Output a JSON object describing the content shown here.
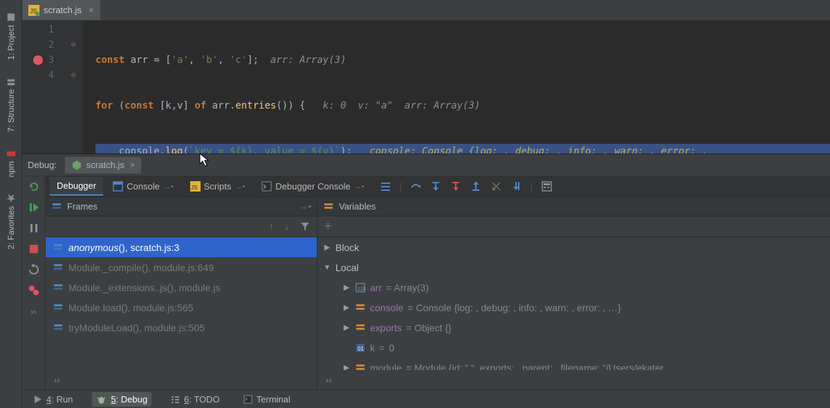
{
  "left_bar": {
    "project": "1: Project",
    "structure": "7: Structure",
    "npm": "npm",
    "favorites": "2: Favorites"
  },
  "editor_tab": {
    "filename": "scratch.js"
  },
  "code": {
    "line1": {
      "kw_const": "const",
      "arr": " arr ",
      "eq": "= [",
      "a": "'a'",
      "c1": ", ",
      "b": "'b'",
      "c2": ", ",
      "c": "'c'",
      "end": "];",
      "hint": "  arr: Array(3)"
    },
    "line2": {
      "kw_for": "for ",
      "p1": "(",
      "kw_const": "const ",
      "dest": "[k,v] ",
      "kw_of": "of ",
      "arr": "arr.",
      "fn": "entries",
      "p2": "()) {",
      "hint": "   k: 0  v: \"a\"  arr: Array(3)"
    },
    "line3": {
      "indent": "    ",
      "obj": "console.",
      "fn": "log",
      "p1": "(",
      "tpl": "`key = ${k}, value = ${v}`",
      "p2": ");",
      "hint": "   console: Console {log: , debug: , info: , warn: , error: ,"
    },
    "line4": {
      "close": "}"
    }
  },
  "gutter_nums": [
    "1",
    "2",
    "3",
    "4"
  ],
  "debug": {
    "label": "Debug:",
    "run_config": "scratch.js"
  },
  "dbg_tabs": {
    "debugger": "Debugger",
    "console": "Console",
    "scripts": "Scripts",
    "dbg_console": "Debugger Console"
  },
  "frames": {
    "title": "Frames",
    "items": [
      {
        "label": "anonymous(), scratch.js:3",
        "sel": true,
        "anon": true
      },
      {
        "label": "Module._compile(), module.js:649",
        "sel": false,
        "anon": false
      },
      {
        "label": "Module._extensions..js(), module.js",
        "sel": false,
        "anon": false
      },
      {
        "label": "Module.load(), module.js:565",
        "sel": false,
        "anon": false
      },
      {
        "label": "tryModuleLoad(), module.js:505",
        "sel": false,
        "anon": false
      }
    ],
    "more": "››"
  },
  "variables": {
    "title": "Variables",
    "scope1": "Block",
    "scope2": "Local",
    "items": [
      {
        "name": "arr",
        "rest": " = Array(3)",
        "kind": "array",
        "expand": true
      },
      {
        "name": "console",
        "rest": " = Console {log: , debug: , info: , warn: , error: , …}",
        "kind": "obj",
        "expand": true
      },
      {
        "name": "exports",
        "rest": " = Object {}",
        "kind": "obj",
        "expand": true
      },
      {
        "name": "k",
        "rest": " = ",
        "val": "0",
        "kind": "prim",
        "expand": false
      },
      {
        "name": "module",
        "rest": " = Module {id: \".\", exports: , parent: , filename: \"/Users/ekater",
        "kind": "obj",
        "expand": true
      }
    ],
    "more": "››"
  },
  "bottom": {
    "run": "4: Run",
    "debug": "5: Debug",
    "todo": "6: TODO",
    "terminal": "Terminal"
  }
}
